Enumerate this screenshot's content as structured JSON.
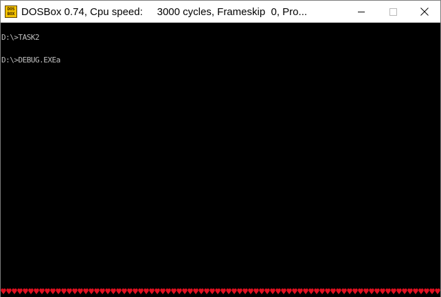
{
  "window": {
    "title": "DOSBox 0.74, Cpu speed:     3000 cycles, Frameskip  0, Pro...",
    "app_icon_letters": [
      "DOS",
      "BOX"
    ],
    "icon": "dosbox-app-icon"
  },
  "caption_buttons": {
    "minimize_icon": "minimize-icon",
    "maximize_icon": "maximize-icon",
    "close_icon": "close-icon"
  },
  "terminal": {
    "lines": [
      "D:\\>TASK2",
      "D:\\>DEBUG.EXEa"
    ],
    "text_color": "#c0c0c0",
    "background": "#000000"
  },
  "status_strip": {
    "glyph": "heart-icon",
    "color": "#e01020"
  }
}
